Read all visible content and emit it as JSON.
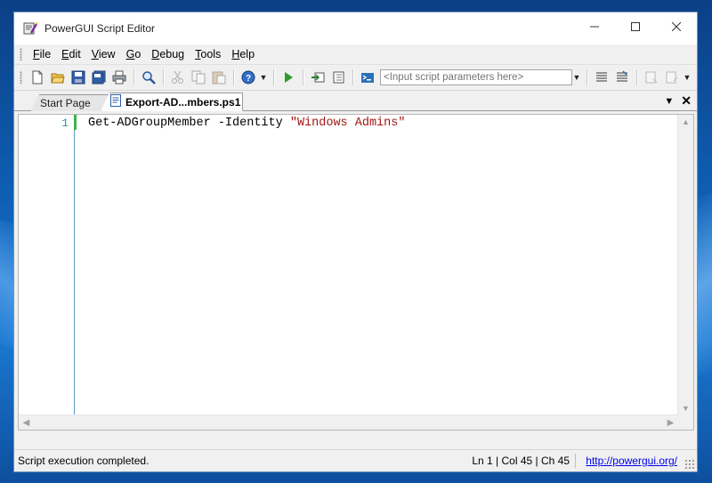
{
  "window": {
    "title": "PowerGUI Script Editor"
  },
  "menu": [
    {
      "label": "File",
      "mnemonic": "F"
    },
    {
      "label": "Edit",
      "mnemonic": "E"
    },
    {
      "label": "View",
      "mnemonic": "V"
    },
    {
      "label": "Go",
      "mnemonic": "G"
    },
    {
      "label": "Debug",
      "mnemonic": "D"
    },
    {
      "label": "Tools",
      "mnemonic": "T"
    },
    {
      "label": "Help",
      "mnemonic": "H"
    }
  ],
  "toolbar": {
    "params_placeholder": "<Input script parameters here>"
  },
  "tabs": [
    {
      "label": "Start Page",
      "active": false
    },
    {
      "label": "Export-AD...mbers.ps1",
      "active": true
    }
  ],
  "editor": {
    "lines": [
      {
        "number": "1",
        "command": "Get-ADGroupMember -Identity ",
        "string": "\"Windows Admins\""
      }
    ]
  },
  "status": {
    "message": "Script execution completed.",
    "position": "Ln 1 | Col 45 | Ch 45",
    "link": "http://powergui.org/"
  },
  "colors": {
    "line_number": "#2b91af",
    "string": "#a31515",
    "change_marker": "#3cb44b",
    "desktop": "#0f63b8"
  }
}
